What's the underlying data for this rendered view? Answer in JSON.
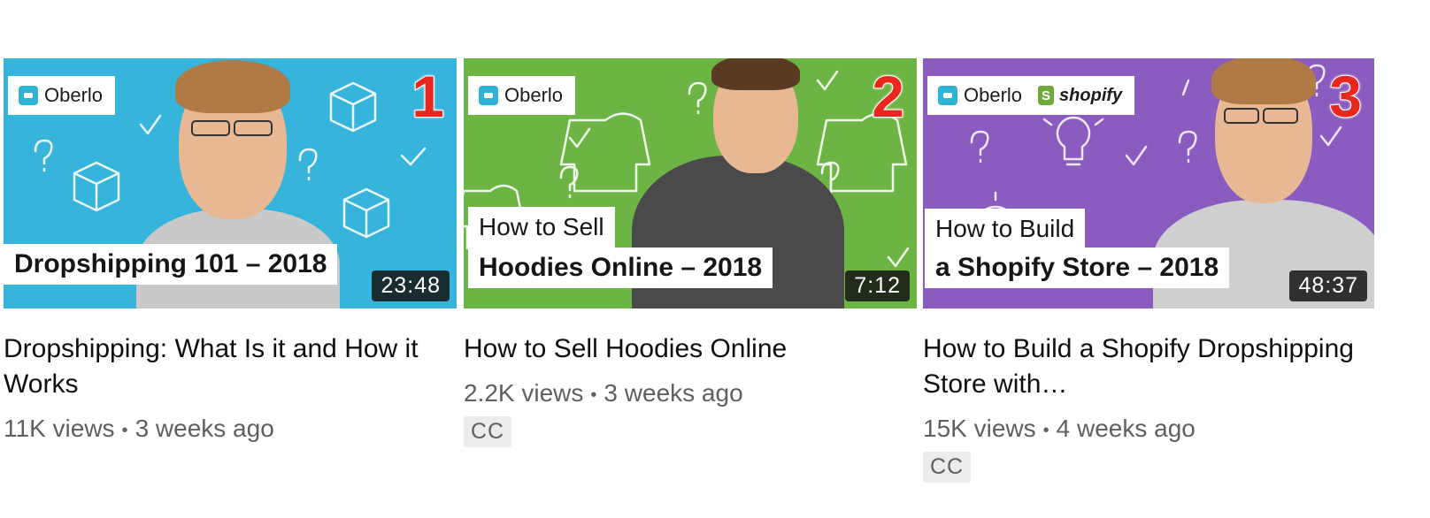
{
  "colors": {
    "thumb1_bg": "#36b4dc",
    "thumb2_bg": "#6cb544",
    "thumb3_bg": "#8a5cc0",
    "rank_number": "#e8281e"
  },
  "videos": [
    {
      "rank": "1",
      "brand_oberlo": "Oberlo",
      "caption_line_2": "Dropshipping 101 – 2018",
      "duration": "23:48",
      "title": "Dropshipping: What Is it and How it Works",
      "views": "11K views",
      "age": "3 weeks ago"
    },
    {
      "rank": "2",
      "brand_oberlo": "Oberlo",
      "caption_line_1": "How to Sell",
      "caption_line_2": "Hoodies Online – 2018",
      "duration": "7:12",
      "title": "How to Sell Hoodies Online",
      "views": "2.2K views",
      "age": "3 weeks ago",
      "badge": "CC"
    },
    {
      "rank": "3",
      "brand_oberlo": "Oberlo",
      "brand_shopify": "shopify",
      "caption_line_1": "How to Build",
      "caption_line_2": "a Shopify Store – 2018",
      "duration": "48:37",
      "title": "How to Build a Shopify Dropshipping Store with…",
      "views": "15K views",
      "age": "4 weeks ago",
      "badge": "CC"
    }
  ],
  "separator": "•"
}
